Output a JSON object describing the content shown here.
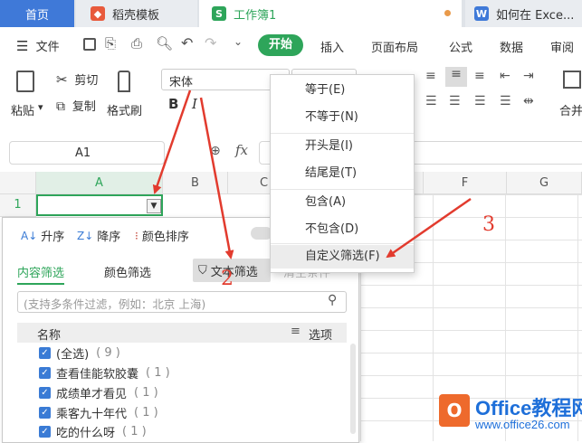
{
  "tabs": [
    {
      "label": "首页"
    },
    {
      "label": "稻壳模板"
    },
    {
      "label": "工作簿1"
    },
    {
      "label": "如何在 Exce..."
    }
  ],
  "menu": {
    "file": "文件",
    "start": "开始",
    "items": [
      "插入",
      "页面布局",
      "公式",
      "数据",
      "审阅"
    ]
  },
  "ribbon": {
    "paste": "粘贴",
    "cut": "剪切",
    "copy": "复制",
    "format_painter": "格式刷",
    "font": "宋体",
    "bold": "B",
    "italic": "I",
    "merge": "合并"
  },
  "formula_bar": {
    "cell_ref": "A1",
    "fx": "fx"
  },
  "grid": {
    "columns": [
      "A",
      "B",
      "C",
      "F",
      "G"
    ],
    "rows": [
      "1"
    ]
  },
  "filter_panel": {
    "sort_asc": "升序",
    "sort_desc": "降序",
    "sort_color": "颜色排序",
    "tab_content": "内容筛选",
    "tab_color": "颜色筛选",
    "tab_text": "文本筛选",
    "clear_condition": "清空条件",
    "search_placeholder": "(支持多条件过滤，例如：北京 上海)",
    "list_header": "名称",
    "options": "选项",
    "items": [
      {
        "label": "(全选)",
        "count": "( 9 )"
      },
      {
        "label": "查看佳能软胶囊",
        "count": "( 1 )"
      },
      {
        "label": "成绩单才看见",
        "count": "( 1 )"
      },
      {
        "label": "乘客九十年代",
        "count": "( 1 )"
      },
      {
        "label": "吃的什么呀",
        "count": "( 1 )"
      }
    ]
  },
  "text_filter_menu": {
    "items": [
      "等于(E)",
      "不等于(N)",
      "开头是(I)",
      "结尾是(T)",
      "包含(A)",
      "不包含(D)",
      "自定义筛选(F)"
    ]
  },
  "annotations": [
    "2",
    "3"
  ],
  "watermark": {
    "logo": "O",
    "brand": "Office教程网",
    "url": "www.office26.com"
  },
  "colors": {
    "accent_green": "#2ea55a",
    "tab_blue": "#3f79d8",
    "arrow_red": "#e23b2e",
    "watermark_blue": "#1e6fd9",
    "watermark_orange": "#ee6a2c"
  }
}
